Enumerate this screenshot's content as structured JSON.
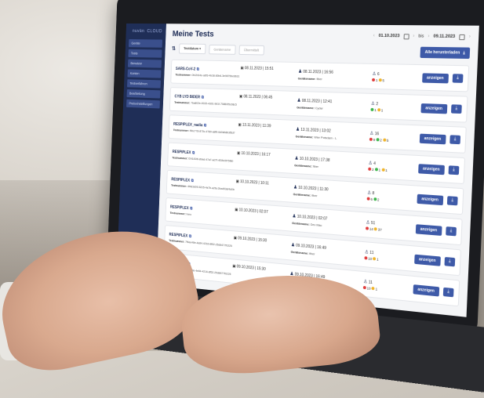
{
  "app": {
    "logo": "nuvän",
    "logo_sub": "CLOUD"
  },
  "sidebar": {
    "items": [
      {
        "label": "Geräte"
      },
      {
        "label": "Tests"
      },
      {
        "label": "Benutzer"
      },
      {
        "label": "Konten"
      },
      {
        "label": "Testverfahren"
      },
      {
        "label": "Bearbeitung"
      },
      {
        "label": "Preiseinstellungen"
      }
    ],
    "bottom_left": "↓",
    "bottom_right": "⇥"
  },
  "header": {
    "title": "Meine Tests",
    "date_from": "01.10.2023",
    "bis_label": "bis",
    "date_to": "09.11.2023"
  },
  "filters": {
    "sort_label": "Testdatum",
    "filter2": "Gerätename",
    "filter3": "Übermittelt",
    "download_all": "Alle herunterladen"
  },
  "rows": [
    {
      "name": "SARS-CoV-2",
      "num": "0fc2b04e-a6f3-4b38-80b6-3e9875be6b31",
      "date1": "08.11.2023 | 15:51",
      "date2": "08.11.2023 | 16:56",
      "device": "fiber",
      "count": "6",
      "red": "1",
      "green": "",
      "yellow": "5",
      "show": "anzeigen"
    },
    {
      "name": "CYB LYD BIDER",
      "num": "7ba602e-5315-4301-981f-75860f5c08c5",
      "date1": "08.11.2023 | 06:45",
      "date2": "08.11.2023 | 12:41",
      "device": "Cyder",
      "count": "2",
      "red": "",
      "green": "1",
      "yellow": "1",
      "show": "anzeigen"
    },
    {
      "name": "RESPIPLEX_nadia",
      "num": "f9bc778-870c-4780-a8f9-6d0db8b3f5d7",
      "date1": "13.11.2023 | 11:39",
      "date2": "13.11.2023 | 13:02",
      "device": "Wier Potsdam - L",
      "count": "16",
      "red": "9",
      "green": "2",
      "yellow": "5",
      "show": "anzeigen"
    },
    {
      "name": "RESPIPLEX",
      "num": "f24181f6-89ad-47a7-ad7f-4f39c9f75f60",
      "date1": "10.10.2023 | 16:17",
      "date2": "10.10.2023 | 17:38",
      "device": "fiber",
      "count": "4",
      "red": "2",
      "green": "1",
      "yellow": "1",
      "show": "anzeigen"
    },
    {
      "name": "RESPIPLEX",
      "num": "4f4d3d09-5225-4a7b-a2fa-2bad53ef4d0b",
      "date1": "10.10.2023 | 10:11",
      "date2": "10.10.2023 | 11:30",
      "device": "fiber",
      "count": "8",
      "red": "6",
      "green": "2",
      "yellow": "",
      "show": "anzeigen"
    },
    {
      "name": "RESPIPLEX",
      "num": "hero",
      "date1": "10.10.2023 | 02:07",
      "date2": "10.10.2023 | 02:07",
      "device": "Dev Mac",
      "count": "51",
      "red": "14",
      "green": "",
      "yellow": "37",
      "show": "anzeigen"
    },
    {
      "name": "RESPIPLEX",
      "num": "7f6ee48e-4e84-4216-8f52-25d8477f0225",
      "date1": "09.10.2023 | 15:30",
      "date2": "09.10.2023 | 16:49",
      "device": "fiber",
      "count": "11",
      "red": "10",
      "green": "",
      "yellow": "1",
      "show": "anzeigen"
    },
    {
      "name": "RESPIPLEX",
      "num": "7f6ee48e-4e84-4216-8f52-25d8477f0225",
      "date1": "09.10.2023 | 15:30",
      "date2": "09.10.2023 | 16:49",
      "device": "fiber",
      "count": "11",
      "red": "10",
      "green": "",
      "yellow": "1",
      "show": "anzeigen"
    }
  ],
  "labels": {
    "testnummer": "Testnummer:",
    "geraetename": "Gerätename:"
  }
}
